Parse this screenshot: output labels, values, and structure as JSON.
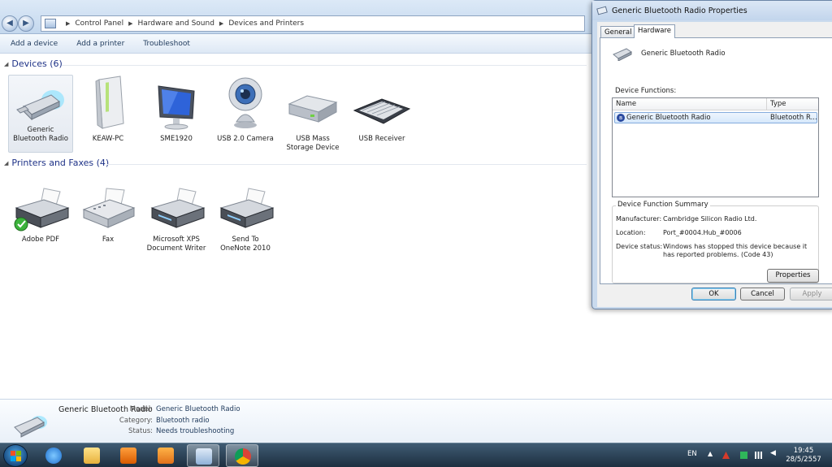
{
  "explorer": {
    "breadcrumb": [
      "Control Panel",
      "Hardware and Sound",
      "Devices and Printers"
    ],
    "commands": [
      "Add a device",
      "Add a printer",
      "Troubleshoot"
    ],
    "groups": {
      "devices_title": "Devices (6)",
      "printers_title": "Printers and Faxes (4)"
    },
    "devices": [
      {
        "line1": "Generic",
        "line2": "Bluetooth Radio",
        "icon": "usb-dongle-icon"
      },
      {
        "line1": "KEAW-PC",
        "line2": "",
        "icon": "desktop-computer-icon"
      },
      {
        "line1": "SME1920",
        "line2": "",
        "icon": "monitor-icon"
      },
      {
        "line1": "USB 2.0 Camera",
        "line2": "",
        "icon": "webcam-icon"
      },
      {
        "line1": "USB Mass",
        "line2": "Storage Device",
        "icon": "external-drive-icon"
      },
      {
        "line1": "USB Receiver",
        "line2": "",
        "icon": "keyboard-icon"
      }
    ],
    "printers": [
      {
        "line1": "Adobe PDF",
        "line2": "",
        "icon": "printer-default-icon"
      },
      {
        "line1": "Fax",
        "line2": "",
        "icon": "fax-icon"
      },
      {
        "line1": "Microsoft XPS",
        "line2": "Document Writer",
        "icon": "printer-icon"
      },
      {
        "line1": "Send To",
        "line2": "OneNote 2010",
        "icon": "printer-icon"
      }
    ],
    "details": {
      "name": "Generic Bluetooth Radio",
      "model_label": "Model:",
      "model_value": "Generic Bluetooth Radio",
      "category_label": "Category:",
      "category_value": "Bluetooth radio",
      "status_label": "Status:",
      "status_value": "Needs troubleshooting"
    }
  },
  "dialog": {
    "title": "Generic Bluetooth Radio Properties",
    "tabs": [
      "General",
      "Hardware"
    ],
    "device_name": "Generic Bluetooth Radio",
    "functions_label": "Device Functions:",
    "columns": [
      "Name",
      "Type"
    ],
    "row": {
      "name": "Generic Bluetooth Radio",
      "type": "Bluetooth R..."
    },
    "summary_title": "Device Function Summary",
    "manufacturer_label": "Manufacturer:",
    "manufacturer_value": "Cambridge Silicon Radio Ltd.",
    "location_label": "Location:",
    "location_value": "Port_#0004.Hub_#0006",
    "status_label": "Device status:",
    "status_value": "Windows has stopped this device because it has reported problems. (Code 43)",
    "properties_button": "Properties",
    "ok": "OK",
    "cancel": "Cancel",
    "apply": "Apply"
  },
  "taskbar": {
    "language": "EN",
    "time": "19:45",
    "date": "28/5/2557",
    "accent": "#1d2f40"
  }
}
